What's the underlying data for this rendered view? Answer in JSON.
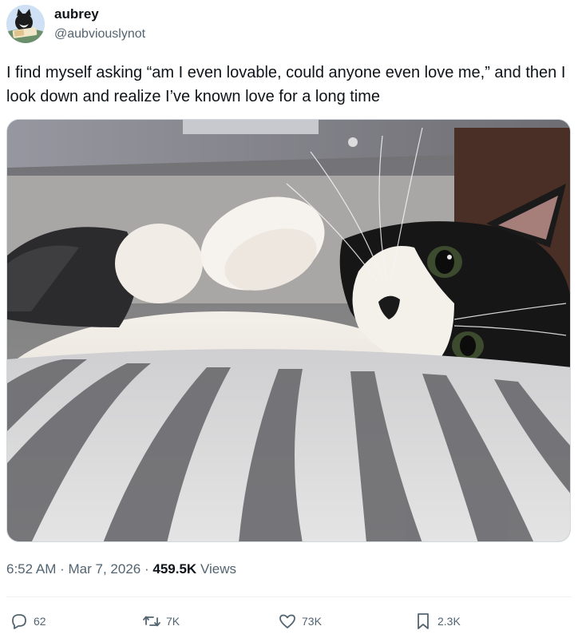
{
  "author": {
    "display_name": "aubrey",
    "handle": "@aubviouslynot",
    "avatar_icon": "avatar-cat-reading"
  },
  "tweet": {
    "text": "I find myself asking “am I even lovable, could anyone even love me,” and then I look down and realize I’ve known love for a long time",
    "time": "6:52 AM",
    "date": "Mar 7, 2026",
    "views_count": "459.5K",
    "views_label": "Views",
    "separator": "·"
  },
  "media": {
    "icon": "photo-black-and-white-cat-lying-on-striped-bed"
  },
  "actions": {
    "replies": "62",
    "reposts": "7K",
    "likes": "73K",
    "bookmarks": "2.3K"
  },
  "colors": {
    "text_primary": "#0f1419",
    "text_secondary": "#536471",
    "divider": "#eff3f4"
  }
}
